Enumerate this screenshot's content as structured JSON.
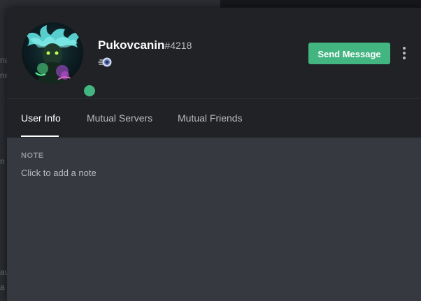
{
  "background": {
    "fragments": [
      "na",
      "ne",
      "n",
      "av",
      "a"
    ]
  },
  "profile": {
    "username": "Pukovcanin",
    "discriminator": "#4218",
    "status": "online",
    "status_color": "#43b581",
    "avatar_icon": "avatar-image",
    "badge_icon": "hypesquad-balance-badge"
  },
  "actions": {
    "send_message_label": "Send Message",
    "send_message_color": "#43b581",
    "more_icon": "kebab-menu-icon"
  },
  "tabs": [
    {
      "label": "User Info",
      "active": true
    },
    {
      "label": "Mutual Servers",
      "active": false
    },
    {
      "label": "Mutual Friends",
      "active": false
    }
  ],
  "note": {
    "label": "NOTE",
    "placeholder": "Click to add a note"
  },
  "colors": {
    "header_bg": "#202225",
    "body_bg": "#36393f",
    "accent_green": "#43b581"
  }
}
